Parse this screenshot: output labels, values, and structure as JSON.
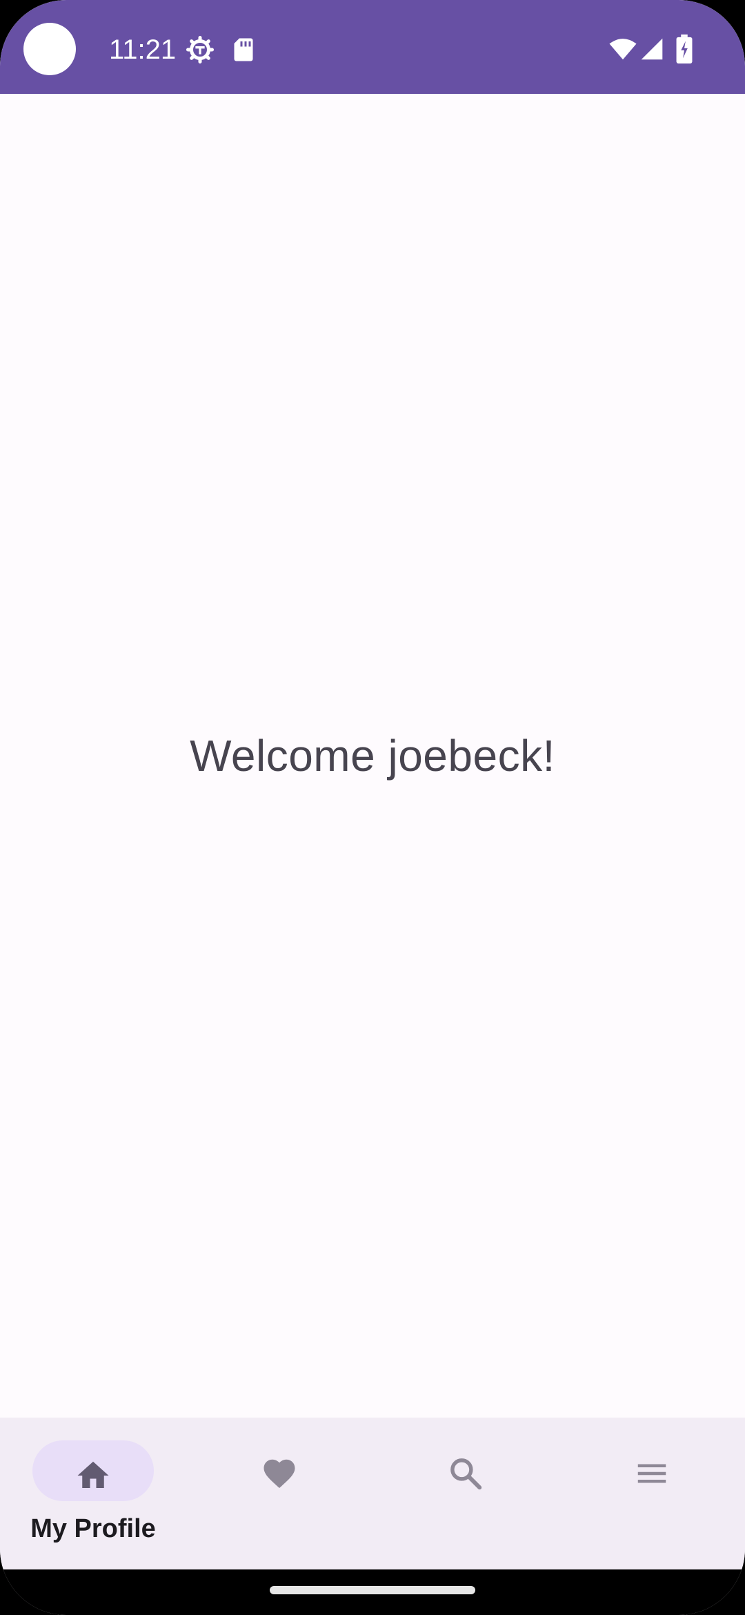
{
  "status_bar": {
    "time": "11:21",
    "icons": [
      "camera-cutout",
      "settings-icon",
      "sd-card-icon",
      "wifi-icon",
      "cell-signal-icon",
      "battery-charging-icon"
    ],
    "background": "#6750a4"
  },
  "main": {
    "welcome_text": "Welcome joebeck!"
  },
  "bottom_nav": {
    "items": [
      {
        "label": "My Profile",
        "icon": "home-icon",
        "selected": true
      },
      {
        "label": "",
        "icon": "heart-icon",
        "selected": false
      },
      {
        "label": "",
        "icon": "search-icon",
        "selected": false
      },
      {
        "label": "",
        "icon": "menu-icon",
        "selected": false
      }
    ],
    "background": "#f2ecf5",
    "indicator_color": "#e8def8"
  },
  "colors": {
    "accent": "#6750a4",
    "text": "#47444f",
    "icon_selected": "#625b71",
    "icon_unselected": "#8e8896"
  }
}
